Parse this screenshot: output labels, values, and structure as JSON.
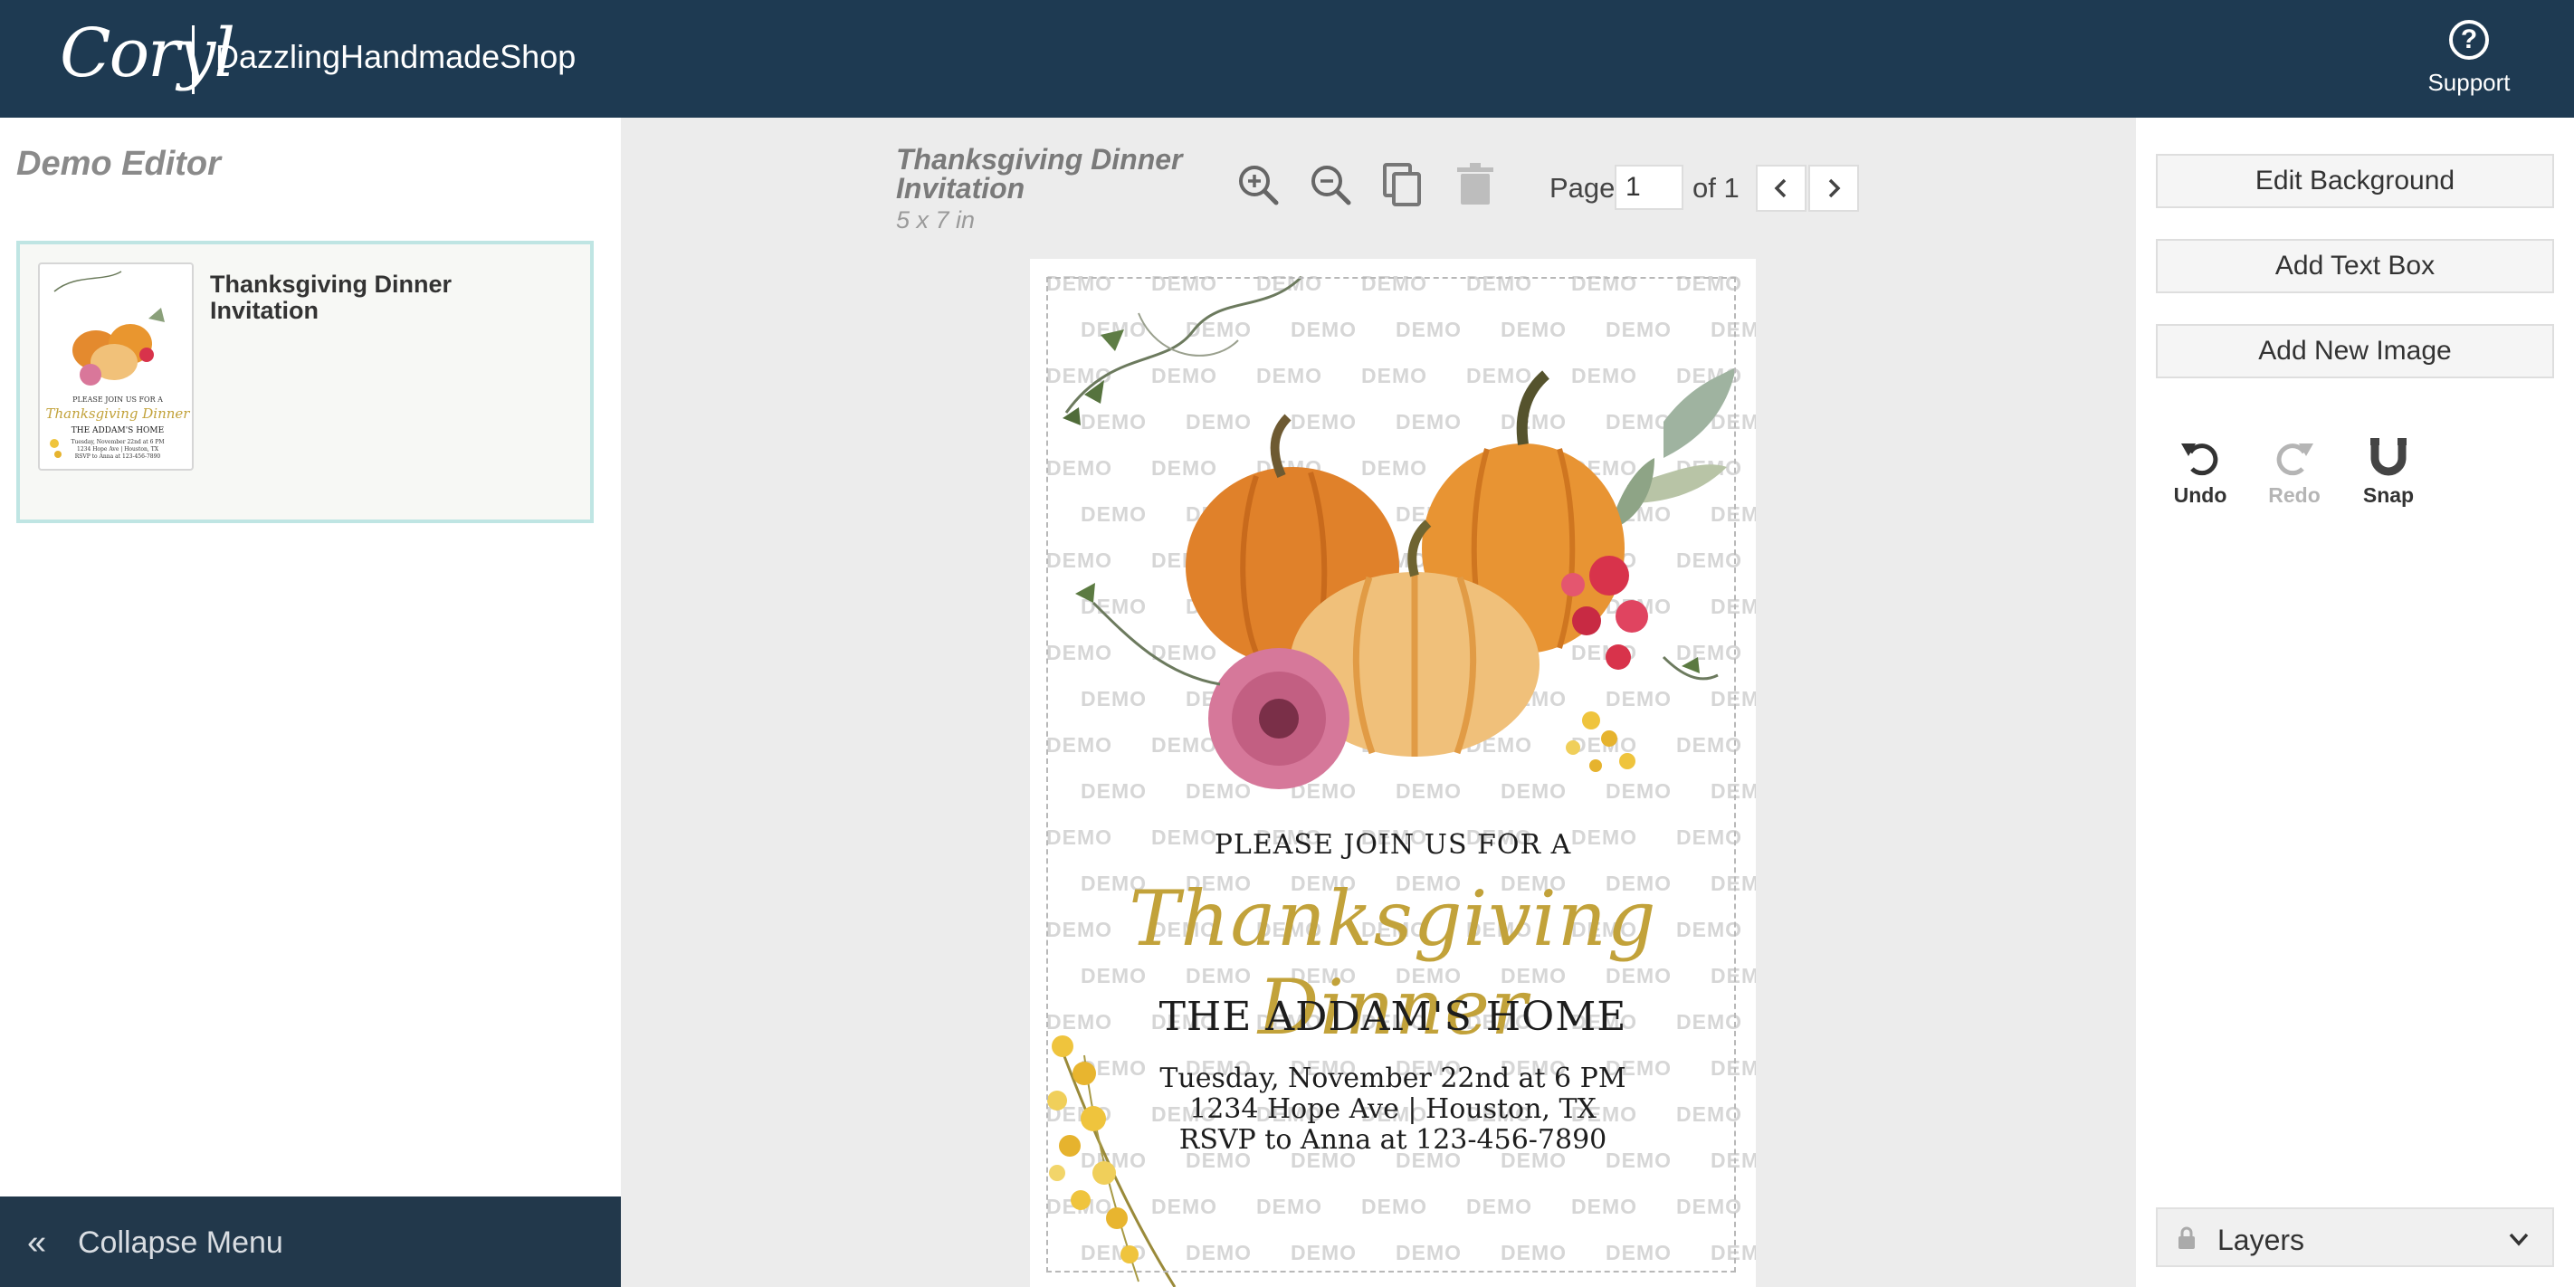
{
  "topbar": {
    "logo_text": "Coryl",
    "shop_name": "DazzlingHandmadeShop",
    "support_label": "Support"
  },
  "left_panel": {
    "editor_title": "Demo Editor",
    "page_card_title": "Thanksgiving Dinner Invitation",
    "collapse_label": "Collapse Menu"
  },
  "canvas": {
    "doc_title": "Thanksgiving Dinner Invitation",
    "doc_size": "5 x 7 in",
    "page_label": "Page",
    "page_value": "1",
    "page_of": "of 1",
    "watermark": "DEMO"
  },
  "invitation": {
    "join_line": "PLEASE JOIN US FOR A",
    "script_title": "Thanksgiving Dinner",
    "home_line": "THE ADDAM'S HOME",
    "date_line": "Tuesday, November 22nd at 6 PM",
    "address_line": "1234 Hope Ave | Houston, TX",
    "rsvp_line": "RSVP to Anna at 123-456-7890"
  },
  "right_panel": {
    "edit_background": "Edit Background",
    "add_text_box": "Add Text Box",
    "add_new_image": "Add New Image",
    "undo_label": "Undo",
    "redo_label": "Redo",
    "snap_label": "Snap",
    "layers_label": "Layers"
  },
  "colors": {
    "topbar": "#1e3a52",
    "collapse_bar": "#22384b",
    "script_gold": "#c2a23a",
    "card_border": "#bfe5e3"
  }
}
